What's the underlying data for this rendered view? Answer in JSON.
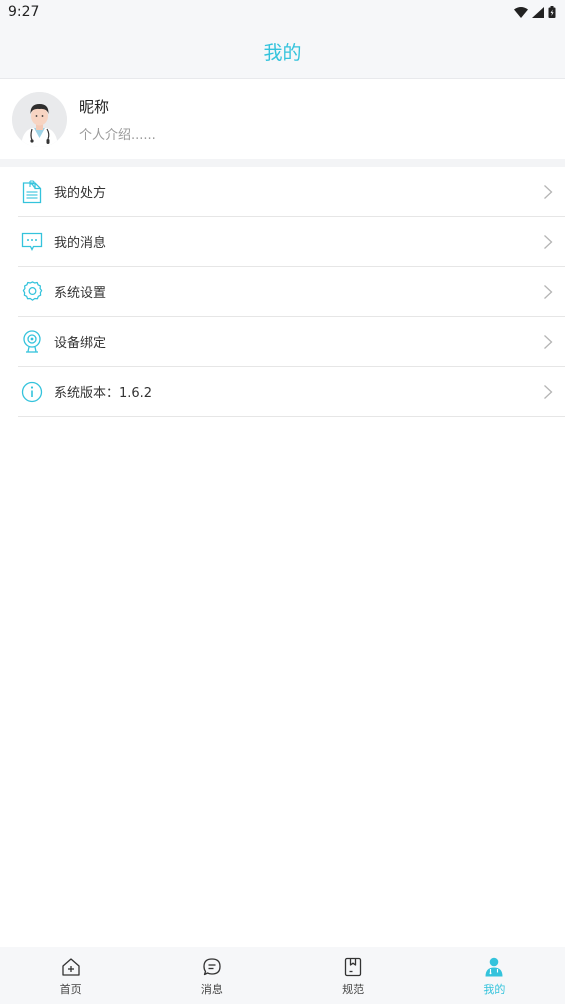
{
  "status_bar": {
    "time": "9:27",
    "icons": [
      "wifi-icon",
      "signal-icon",
      "battery-icon"
    ]
  },
  "header": {
    "title": "我的"
  },
  "profile": {
    "nickname": "昵称",
    "intro": "个人介绍......",
    "avatar": "doctor-avatar"
  },
  "menu": {
    "items": [
      {
        "label": "我的处方",
        "icon": "prescription-icon"
      },
      {
        "label": "我的消息",
        "icon": "message-icon"
      },
      {
        "label": "系统设置",
        "icon": "settings-icon"
      },
      {
        "label": "设备绑定",
        "icon": "webcam-icon"
      },
      {
        "label": "系统版本：1.6.2",
        "icon": "info-icon"
      }
    ]
  },
  "bottom_nav": {
    "items": [
      {
        "label": "首页",
        "icon": "home-icon"
      },
      {
        "label": "消息",
        "icon": "chat-icon"
      },
      {
        "label": "规范",
        "icon": "guideline-icon"
      },
      {
        "label": "我的",
        "icon": "user-icon",
        "active": true
      }
    ]
  },
  "colors": {
    "accent": "#34c3dc",
    "background": "#ffffff",
    "bar_background": "#f6f7f9"
  }
}
